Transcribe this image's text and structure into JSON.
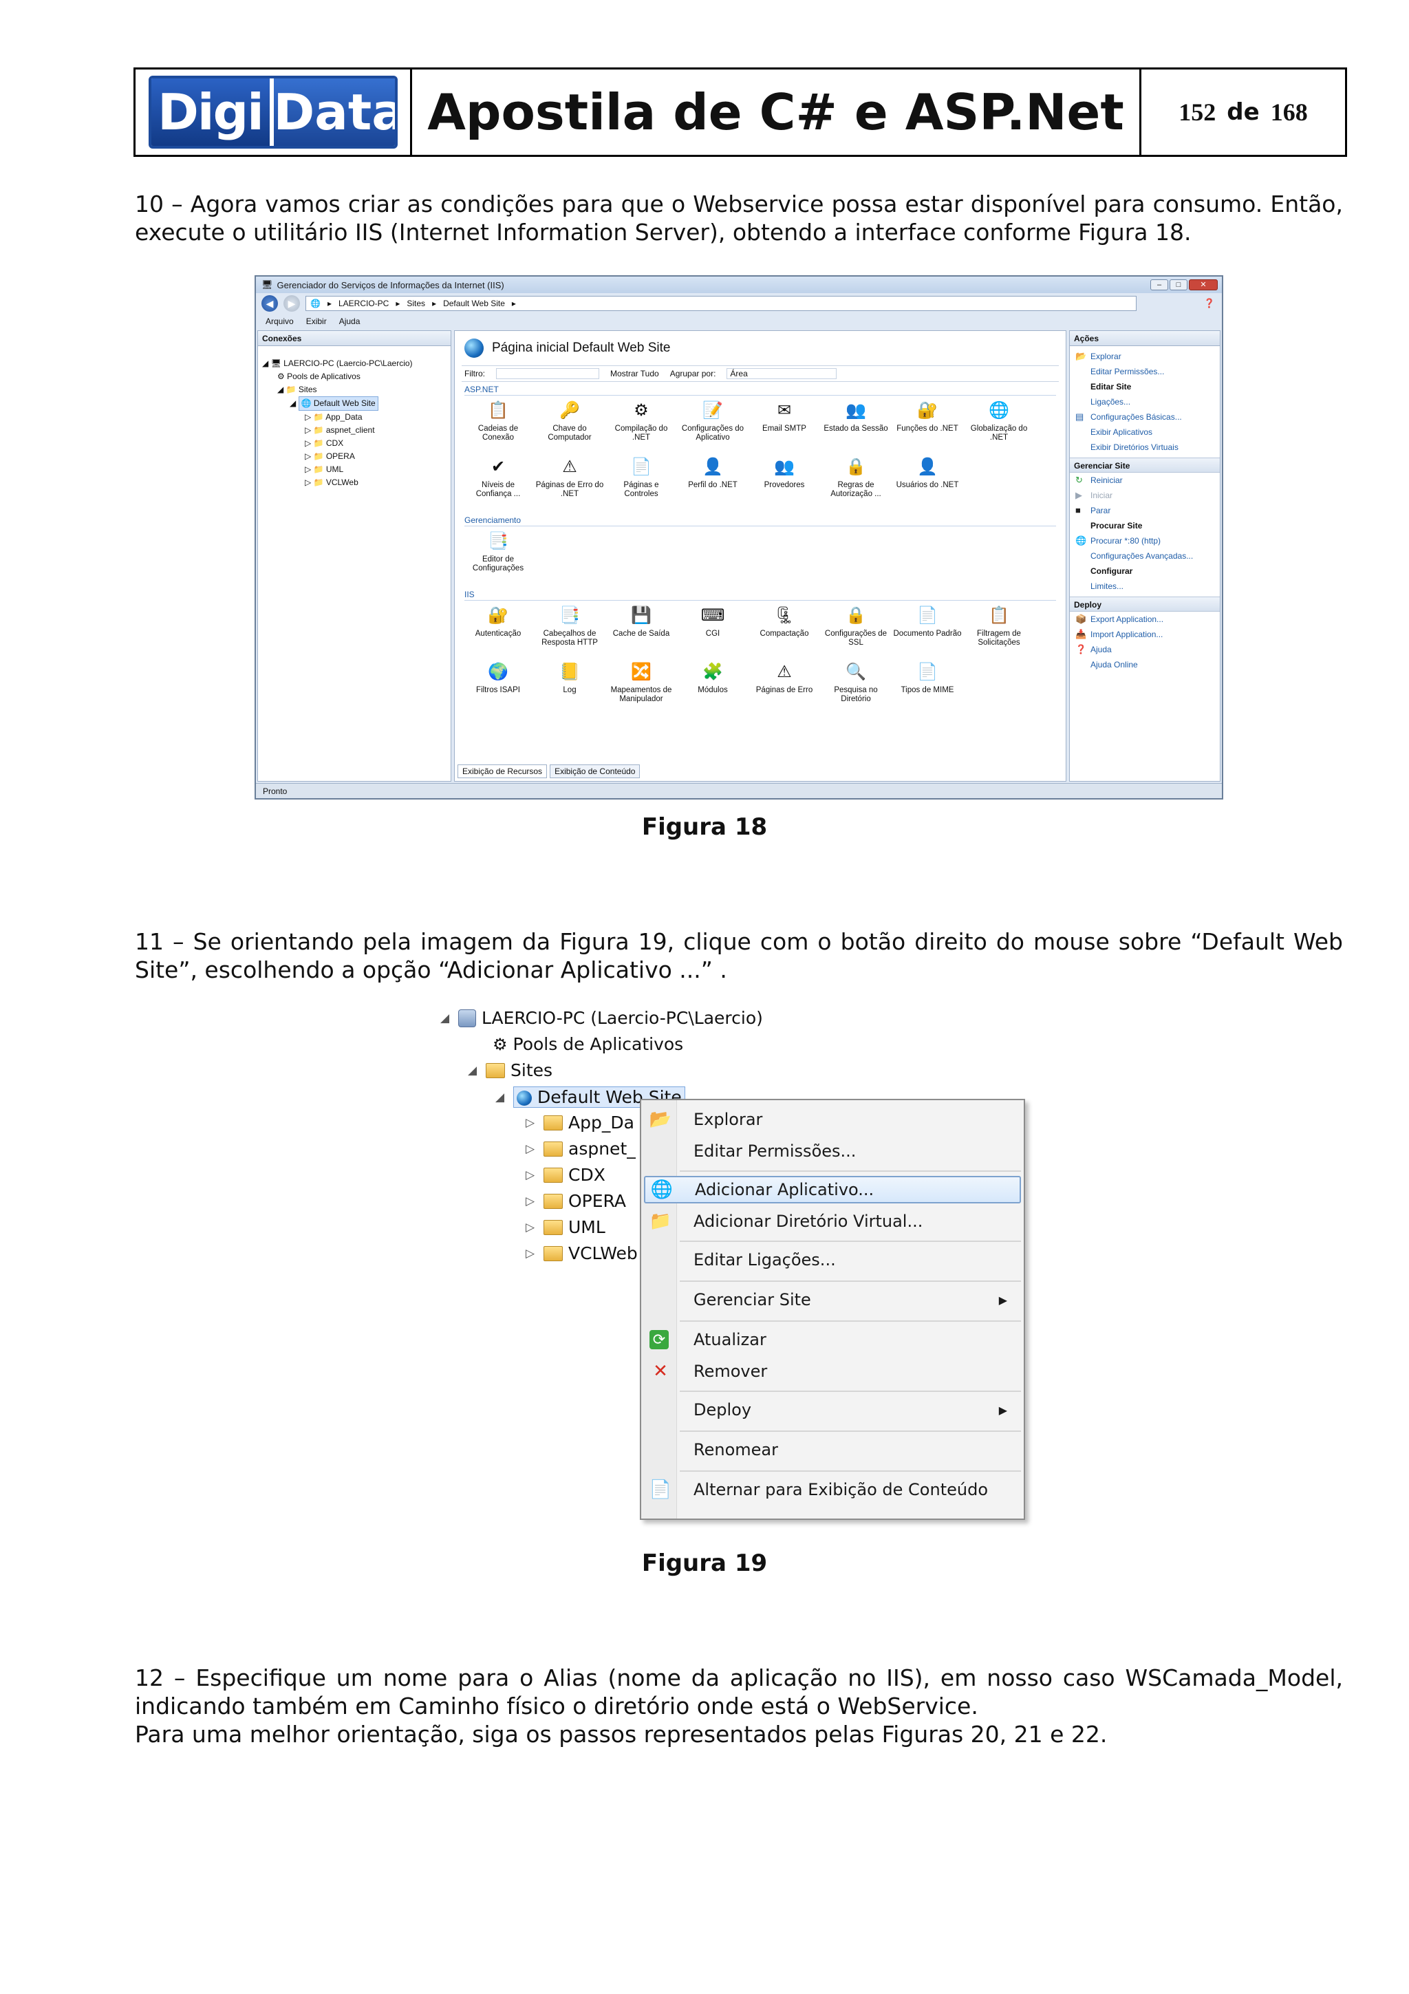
{
  "header": {
    "logo_left": "Digi",
    "logo_right": "Data",
    "title": "Apostila de C# e ASP.Net",
    "page_current": "152",
    "page_sep": "de",
    "page_total": "168"
  },
  "para10": "10 – Agora vamos criar as condições para que o Webservice possa estar disponível para consumo.  Então, execute o utilitário IIS (Internet Information Server), obtendo a interface conforme Figura 18.",
  "fig18": {
    "caption": "Figura 18",
    "window_title": "Gerenciador do Serviços de Informações da Internet (IIS)",
    "address": [
      "LAERCIO-PC",
      "Sites",
      "Default Web Site"
    ],
    "menu": [
      "Arquivo",
      "Exibir",
      "Ajuda"
    ],
    "connections_title": "Conexões",
    "tree": {
      "server": "LAERCIO-PC (Laercio-PC\\Laercio)",
      "pools": "Pools de Aplicativos",
      "sites": "Sites",
      "site": "Default Web Site",
      "folders": [
        "App_Data",
        "aspnet_client",
        "CDX",
        "OPERA",
        "UML",
        "VCLWeb"
      ]
    },
    "home_title": "Página inicial Default Web Site",
    "filter_label": "Filtro:",
    "show_all": "Mostrar Tudo",
    "group_by": "Agrupar por:",
    "group_value": "Área",
    "groups": {
      "aspnet": "ASP.NET",
      "management": "Gerenciamento",
      "iis": "IIS"
    },
    "aspnet_icons": [
      "Cadeias de Conexão",
      "Chave do Computador",
      "Compilação do .NET",
      "Configurações do Aplicativo",
      "Email SMTP",
      "Estado da Sessão",
      "Funções do .NET",
      "Globalização do .NET",
      "Níveis de Confiança ...",
      "Páginas de Erro do .NET",
      "Páginas e Controles",
      "Perfil do .NET",
      "Provedores",
      "Regras de Autorização ...",
      "Usuários do .NET"
    ],
    "management_icons": [
      "Editor de Configurações"
    ],
    "iis_icons": [
      "Autenticação",
      "Cabeçalhos de Resposta HTTP",
      "Cache de Saída",
      "CGI",
      "Compactação",
      "Configurações de SSL",
      "Documento Padrão",
      "Filtragem de Solicitações",
      "Filtros ISAPI",
      "Log",
      "Mapeamentos de Manipulador",
      "Módulos",
      "Páginas de Erro",
      "Pesquisa no Diretório",
      "Tipos de MIME"
    ],
    "tabs": [
      "Exibição de Recursos",
      "Exibição de Conteúdo"
    ],
    "actions_title": "Ações",
    "actions": {
      "explore": "Explorar",
      "edit_perms": "Editar Permissões...",
      "edit_site": "Editar Site",
      "bindings": "Ligações...",
      "basic_settings": "Configurações Básicas...",
      "view_apps": "Exibir Aplicativos",
      "view_vdirs": "Exibir Diretórios Virtuais",
      "manage_site": "Gerenciar Site",
      "restart": "Reiniciar",
      "start": "Iniciar",
      "stop": "Parar",
      "browse_site": "Procurar Site",
      "browse_80": "Procurar *:80 (http)",
      "advanced": "Configurações Avançadas...",
      "configure": "Configurar",
      "limits": "Limites...",
      "deploy": "Deploy",
      "export": "Export Application...",
      "import": "Import Application...",
      "help": "Ajuda",
      "help_online": "Ajuda Online"
    },
    "status": "Pronto"
  },
  "para11": "11 – Se orientando pela imagem da Figura 19, clique com o botão direito do mouse sobre “Default Web Site”, escolhendo a opção  “Adicionar Aplicativo ...” .",
  "fig19": {
    "caption": "Figura 19",
    "server": "LAERCIO-PC (Laercio-PC\\Laercio)",
    "pools": "Pools de Aplicativos",
    "sites": "Sites",
    "site": "Default Web Site",
    "folders": [
      "App_Da",
      "aspnet_",
      "CDX",
      "OPERA",
      "UML",
      "VCLWeb"
    ],
    "menu": [
      "Explorar",
      "Editar Permissões...",
      "Adicionar Aplicativo...",
      "Adicionar Diretório Virtual...",
      "Editar Ligações...",
      "Gerenciar Site",
      "Atualizar",
      "Remover",
      "Deploy",
      "Renomear",
      "Alternar para Exibição de Conteúdo"
    ]
  },
  "para12": "12 – Especifique um nome para o Alias (nome da aplicação no IIS), em nosso caso WSCamada_Model, indicando também em Caminho físico o diretório onde está o WebService.",
  "para12b": "Para uma melhor orientação, siga os passos representados pelas Figuras 20, 21 e 22."
}
